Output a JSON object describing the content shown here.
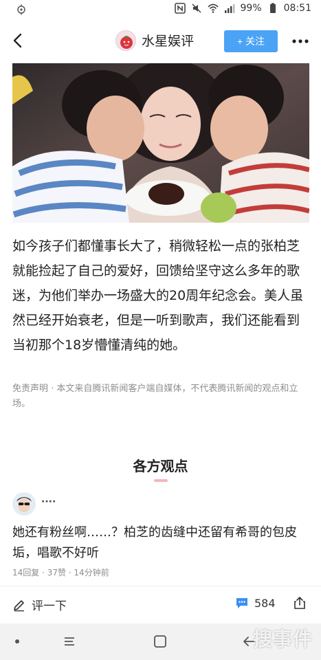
{
  "status_bar": {
    "battery": "99%",
    "time": "08:51",
    "icons": [
      "location-icon",
      "nfc-icon",
      "mute-icon",
      "wifi-icon",
      "signal-icon",
      "battery-icon"
    ]
  },
  "header": {
    "title": "水星娱评",
    "follow_label": "+ 关注",
    "back_icon": "chevron-left-icon",
    "more_icon": "more-dots-icon"
  },
  "photo": {
    "semantic": "mother-with-two-boys-photo"
  },
  "article": {
    "text": "如今孩子们都懂事长大了，稍微轻松一点的张柏芝就能捡起了自己的爱好，回馈给坚守这么多年的歌迷，为他们举办一场盛大的20周年纪念会。美人虽然已经开始衰老，但是一听到歌声，我们还能看到当初那个18岁懵懂清纯的她。"
  },
  "disclaimer": "免责声明 · 本文来自腾讯新闻客户端自媒体，不代表腾讯新闻的观点和立场。",
  "section": {
    "title": "各方观点"
  },
  "comment": {
    "user": "····",
    "text": "她还有粉丝啊……？柏芝的齿缝中还留有希哥的包皮垢，唱歌不好听",
    "meta": "14回复 · 37赞 · 14分钟前"
  },
  "toolbar": {
    "write_label": "评一下",
    "comment_count": "584"
  },
  "watermark": "搜事件",
  "colors": {
    "accent": "#4aa3f4",
    "section_bar": "#f2b7b9",
    "muted_text": "#8e8e8e"
  }
}
